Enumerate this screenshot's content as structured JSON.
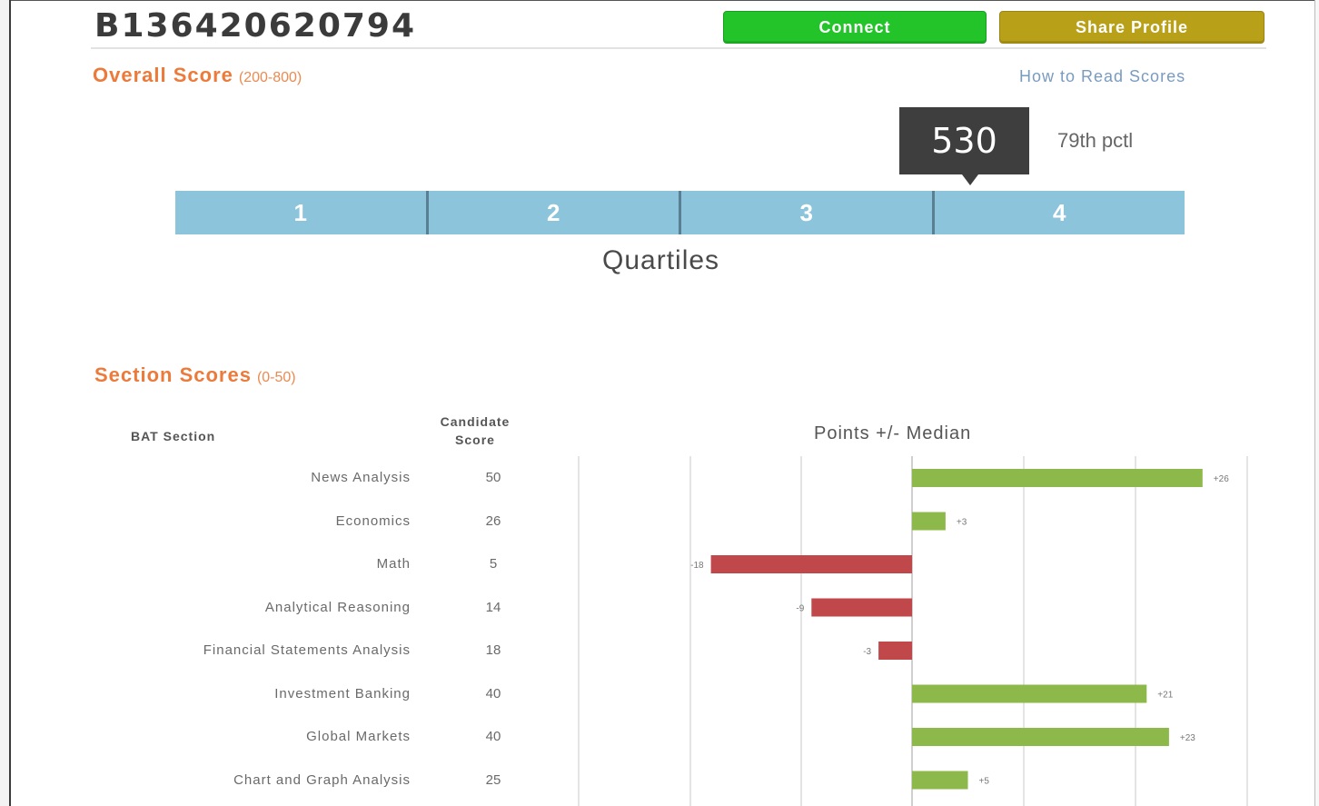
{
  "profile": {
    "id": "B136420620794"
  },
  "actions": {
    "connect_label": "Connect",
    "share_label": "Share Profile",
    "how_to_label": "How to Read Scores"
  },
  "overall": {
    "title": "Overall Score",
    "range": "(200-800)",
    "score": "530",
    "percentile": "79th pctl",
    "quartiles": [
      "1",
      "2",
      "3",
      "4"
    ],
    "quartiles_label": "Quartiles"
  },
  "sections": {
    "title": "Section Scores",
    "range": "(0-50)",
    "col_section": "BAT Section",
    "col_score_line1": "Candidate",
    "col_score_line2": "Score",
    "col_points": "Points +/- Median",
    "rows": [
      {
        "name": "News Analysis",
        "score": "50"
      },
      {
        "name": "Economics",
        "score": "26"
      },
      {
        "name": "Math",
        "score": "5"
      },
      {
        "name": "Analytical Reasoning",
        "score": "14"
      },
      {
        "name": "Financial Statements Analysis",
        "score": "18"
      },
      {
        "name": "Investment Banking",
        "score": "40"
      },
      {
        "name": "Global Markets",
        "score": "40"
      },
      {
        "name": "Chart and Graph Analysis",
        "score": "25"
      }
    ]
  },
  "chart_data": {
    "type": "bar",
    "orientation": "horizontal",
    "categories": [
      "News Analysis",
      "Economics",
      "Math",
      "Analytical Reasoning",
      "Financial Statements Analysis",
      "Investment Banking",
      "Global Markets",
      "Chart and Graph Analysis"
    ],
    "values": [
      26,
      3,
      -18,
      -9,
      -3,
      21,
      23,
      5
    ],
    "labels": [
      "+26",
      "+3",
      "-18",
      "-9",
      "-3",
      "+21",
      "+23",
      "+5"
    ],
    "xlabel": "Points +/- Median",
    "xlim": [
      -30,
      30
    ],
    "grid": true,
    "positive_color": "#8db94a",
    "negative_color": "#c0474a"
  },
  "colors": {
    "connect": "#22c429",
    "share": "#b8a019",
    "accent": "#ec7a3a",
    "quartile": "#8cc4dc"
  }
}
